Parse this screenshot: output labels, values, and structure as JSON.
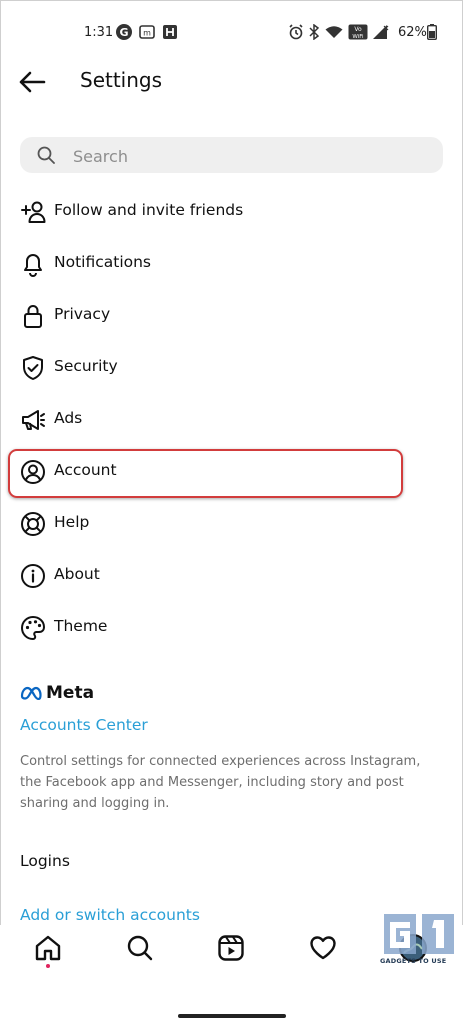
{
  "status_bar": {
    "time": "1:31",
    "battery_percent": "62%",
    "vowifi": "Vo WiFi"
  },
  "header": {
    "title": "Settings"
  },
  "search": {
    "placeholder": "Search"
  },
  "menu": {
    "items": [
      {
        "label": "Follow and invite friends",
        "icon": "add-person-icon"
      },
      {
        "label": "Notifications",
        "icon": "bell-icon"
      },
      {
        "label": "Privacy",
        "icon": "lock-icon"
      },
      {
        "label": "Security",
        "icon": "shield-check-icon"
      },
      {
        "label": "Ads",
        "icon": "megaphone-icon"
      },
      {
        "label": "Account",
        "icon": "user-circle-icon"
      },
      {
        "label": "Help",
        "icon": "lifebuoy-icon"
      },
      {
        "label": "About",
        "icon": "info-icon"
      },
      {
        "label": "Theme",
        "icon": "palette-icon"
      }
    ]
  },
  "meta": {
    "logo_text": "Meta",
    "accounts_center": "Accounts Center",
    "description": "Control settings for connected experiences across Instagram, the Facebook app and Messenger, including story and post sharing and logging in."
  },
  "logins": {
    "title": "Logins",
    "add_switch": "Add or switch accounts"
  },
  "watermark": {
    "text": "GADGETS TO USE"
  },
  "colors": {
    "link": "#2a9fd6",
    "highlight": "#d23c3c",
    "notification_dot": "#e0245e"
  }
}
